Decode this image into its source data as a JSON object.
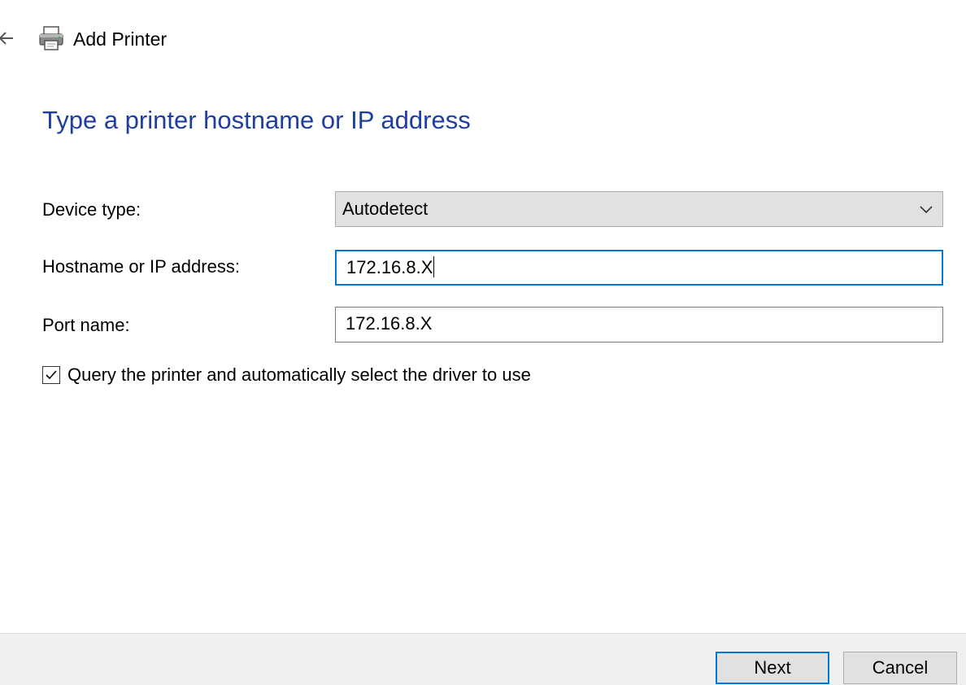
{
  "window": {
    "title": "Add Printer",
    "back_icon": "back-arrow-icon",
    "app_icon": "printer-icon"
  },
  "page": {
    "heading": "Type a printer hostname or IP address"
  },
  "form": {
    "device_type": {
      "label": "Device type:",
      "selected": "Autodetect",
      "icon": "chevron-down-icon"
    },
    "hostname": {
      "label": "Hostname or IP address:",
      "value": "172.16.8.X",
      "focused": true
    },
    "port_name": {
      "label": "Port name:",
      "value": "172.16.8.X"
    },
    "query_checkbox": {
      "label": "Query the printer and automatically select the driver to use",
      "checked": true
    }
  },
  "footer": {
    "next_label": "Next",
    "cancel_label": "Cancel"
  },
  "colors": {
    "heading": "#1e3f9f",
    "focus_border": "#0078d7",
    "footer_bg": "#f0f0f0",
    "button_bg": "#e1e1e1"
  }
}
